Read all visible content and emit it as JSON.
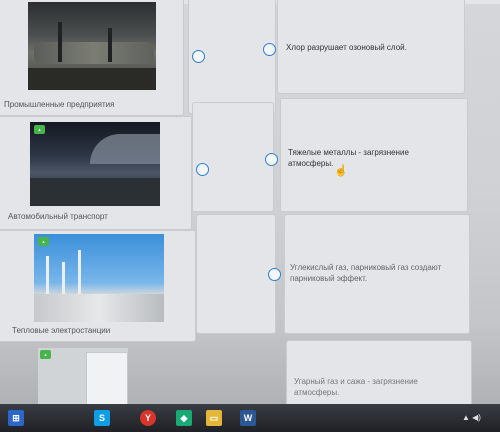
{
  "task": {
    "rows": [
      {
        "caption": "Промышленные предприятия",
        "statement": "Хлор разрушает озоновый слой.",
        "image_icon": "factory-photo"
      },
      {
        "caption": "Автомобильный транспорт",
        "statement": "Тяжелые металлы - загрязнение атмосферы.",
        "image_icon": "car-photo"
      },
      {
        "caption": "Тепловые электростанции",
        "statement": "Углекислый газ, парниковый газ создают парниковый эффект.",
        "image_icon": "power-plant-photo"
      },
      {
        "caption": "",
        "statement": "Угарный газ и сажа - загрязнение атмосферы.",
        "image_icon": "refrigerator-photo"
      }
    ]
  },
  "taskbar": {
    "icons": [
      {
        "name": "start-icon",
        "label": ""
      },
      {
        "name": "skype-icon",
        "label": "S"
      },
      {
        "name": "yandex-browser-icon",
        "label": "Y"
      },
      {
        "name": "apps-icon",
        "label": ""
      },
      {
        "name": "file-explorer-icon",
        "label": ""
      },
      {
        "name": "word-icon",
        "label": "W"
      }
    ]
  },
  "colors": {
    "radio": "#2f7fd1",
    "accent_badge": "#47b54b"
  }
}
